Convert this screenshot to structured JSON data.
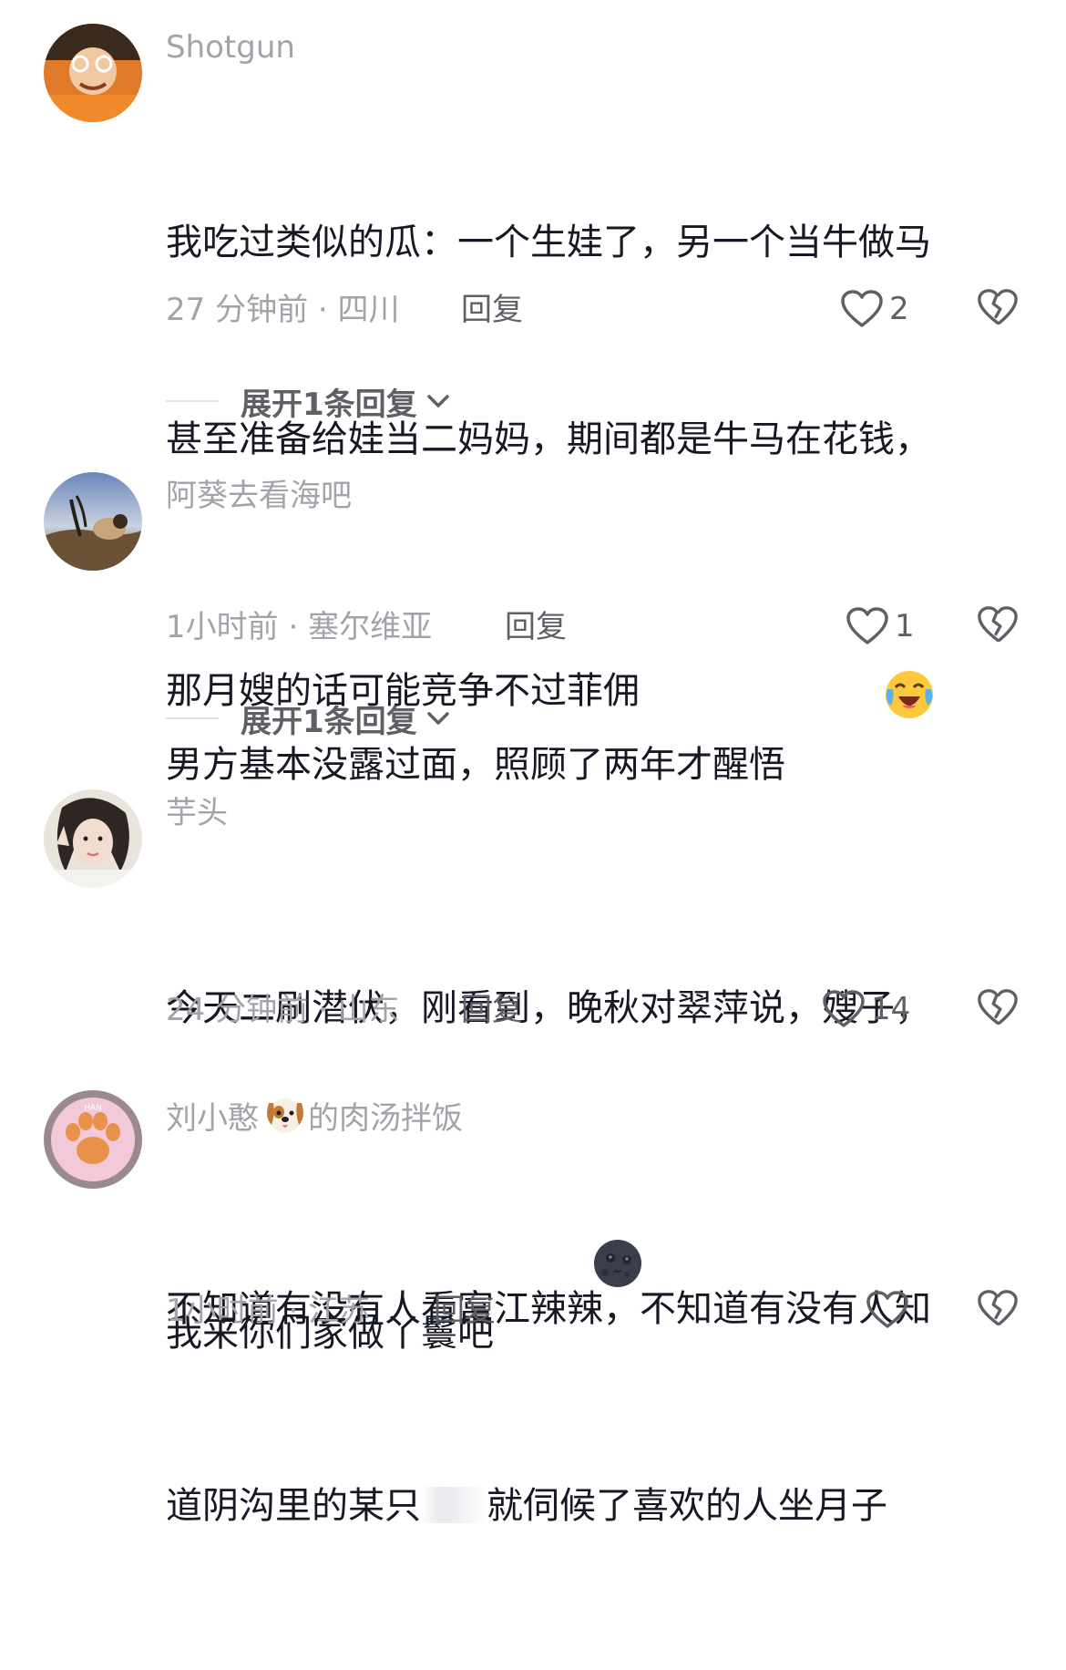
{
  "comments": [
    {
      "username": "Shotgun",
      "text_lines": [
        "我吃过类似的瓜：一个生娃了，另一个当牛做马",
        "甚至准备给娃当二妈妈，期间都是牛马在花钱，",
        "男方基本没露过面，照顾了两年才醒悟"
      ],
      "emoji": "crying-laughing-emoji",
      "time": "27 分钟前",
      "location": "四川",
      "reply_label": "回复",
      "likes": "2",
      "expand_label": "展开1条回复"
    },
    {
      "username": "阿葵去看海吧",
      "text_lines": [
        "那月嫂的话可能竞争不过菲佣"
      ],
      "time": "1小时前",
      "location": "塞尔维亚",
      "reply_label": "回复",
      "likes": "1",
      "expand_label": "展开1条回复"
    },
    {
      "username": "芋头",
      "text_lines": [
        "今天二刷潜伏，刚看到，晚秋对翠萍说，嫂子，",
        "我来你们家做丫鬟吧"
      ],
      "emoji": "new-moon-face-emoji",
      "time": "24 分钟前",
      "location": "山东",
      "reply_label": "回复",
      "likes": "14"
    },
    {
      "username_prefix": "刘小憨",
      "username_emoji": "dog-face-emoji",
      "username_suffix": "的肉汤拌饭",
      "text_line_1": "不知道有没有人看富江辣辣，不知道有没有人知",
      "text_line_2_prefix": "道阴沟里的某只",
      "text_line_2_suffix": "就伺候了喜欢的人坐月子",
      "time": "1小时前",
      "location": "江苏",
      "reply_label": "回复",
      "likes": ""
    }
  ],
  "meta_separator": "·",
  "icons": {
    "like": "heart-outline-icon",
    "dislike": "broken-heart-icon",
    "expand": "chevron-down-icon"
  },
  "colors": {
    "text": "#161823",
    "secondary": "#a3a3aa",
    "action": "#5f5f66"
  }
}
